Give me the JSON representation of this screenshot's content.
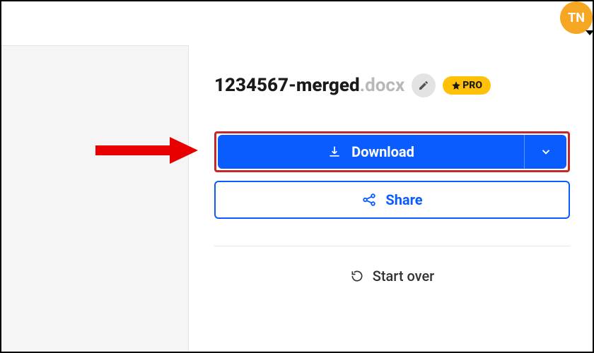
{
  "avatar": {
    "initials": "TN"
  },
  "file": {
    "name": "1234567-merged",
    "ext": ".docx"
  },
  "badge": {
    "pro": "PRO"
  },
  "buttons": {
    "download": "Download",
    "share": "Share",
    "start_over": "Start over"
  },
  "colors": {
    "primary": "#0a5cff",
    "highlight": "#c62828",
    "pro": "#ffc107",
    "avatar": "#f5a623"
  }
}
